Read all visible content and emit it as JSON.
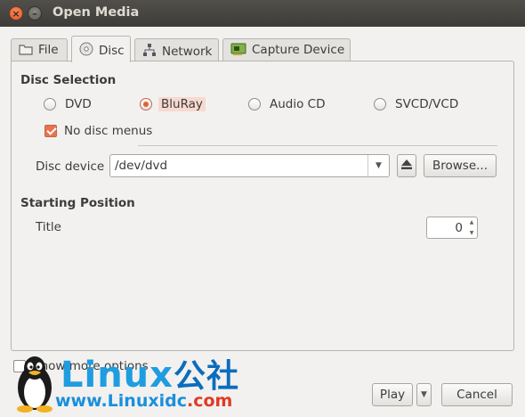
{
  "window": {
    "title": "Open Media"
  },
  "tabs": [
    {
      "label": "File",
      "icon": "folder-icon"
    },
    {
      "label": "Disc",
      "icon": "disc-icon"
    },
    {
      "label": "Network",
      "icon": "network-icon"
    },
    {
      "label": "Capture Device",
      "icon": "capture-card-icon"
    }
  ],
  "disc_selection": {
    "heading": "Disc Selection",
    "options": [
      "DVD",
      "BluRay",
      "Audio CD",
      "SVCD/VCD"
    ],
    "selected": "BluRay",
    "no_disc_menus": {
      "label": "No disc menus",
      "checked": true
    },
    "device_label": "Disc device",
    "device_value": "/dev/dvd",
    "browse_label": "Browse..."
  },
  "starting_position": {
    "heading": "Starting Position",
    "title_label": "Title",
    "title_value": "0"
  },
  "footer": {
    "show_more_label": "Show more options",
    "play_label": "Play",
    "cancel_label": "Cancel"
  },
  "watermark": {
    "brand_latin": "Linux",
    "brand_cn": "公社",
    "url_prefix": "www.",
    "url_domain": "Linuxidc",
    "url_suffix": ".com"
  },
  "colors": {
    "accent": "#e9724b",
    "titlebar": "#3d3c38",
    "watermark": "#1f9de0"
  }
}
